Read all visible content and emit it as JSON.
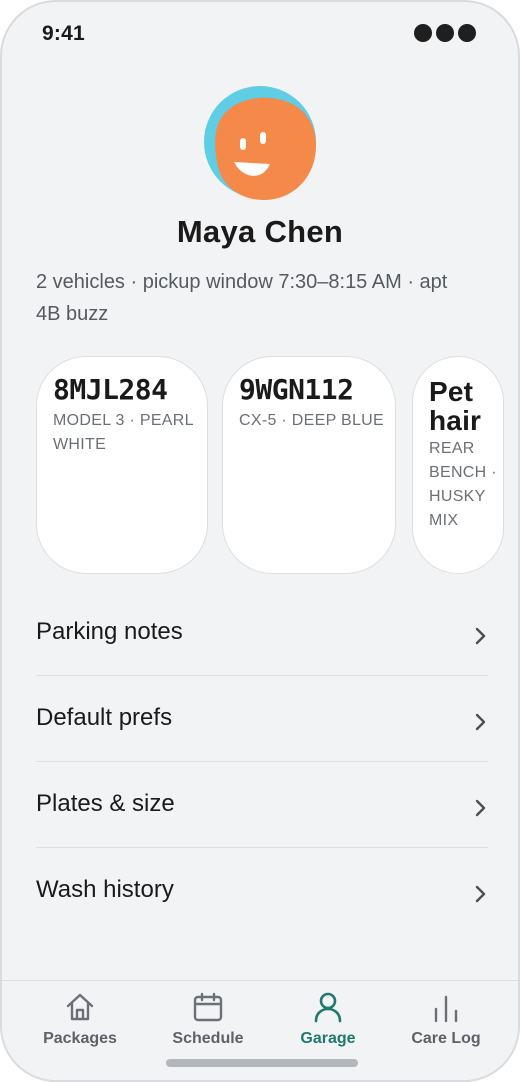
{
  "status_bar": {
    "time": "9:41"
  },
  "profile": {
    "name": "Maya Chen",
    "meta": "2 vehicles · pickup window 7:30–8:15 AM · apt 4B buzz"
  },
  "vehicles": [
    {
      "title": "8MJL284",
      "subtitle": "MODEL 3 · PEARL WHITE"
    },
    {
      "title": "9WGN112",
      "subtitle": "CX-5 · DEEP BLUE"
    },
    {
      "title": "Pet hair",
      "subtitle": "REAR BENCH · HUSKY MIX"
    }
  ],
  "menu": {
    "items": [
      {
        "label": "Parking notes"
      },
      {
        "label": "Default prefs"
      },
      {
        "label": "Plates & size"
      },
      {
        "label": "Wash history"
      }
    ]
  },
  "tabs": [
    {
      "label": "Packages",
      "icon": "home-icon",
      "active": false
    },
    {
      "label": "Schedule",
      "icon": "calendar-icon",
      "active": false
    },
    {
      "label": "Garage",
      "icon": "person-icon",
      "active": true
    },
    {
      "label": "Care Log",
      "icon": "bar-chart-icon",
      "active": false
    }
  ],
  "colors": {
    "accent": "#1f7a6c",
    "avatar_orange": "#f5894a",
    "avatar_cyan": "#5fcde4",
    "background": "#f2f3f5"
  }
}
